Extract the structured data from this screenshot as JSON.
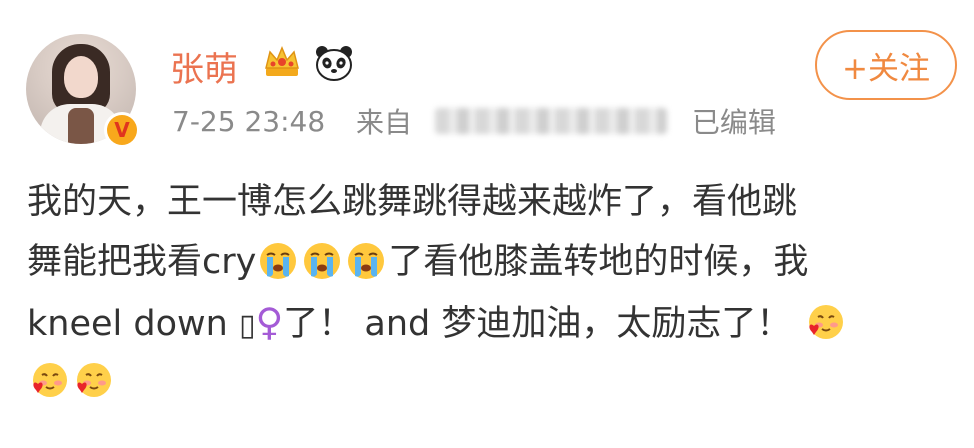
{
  "post": {
    "user": {
      "name": "张萌",
      "badges": [
        "crown-icon",
        "panda-icon"
      ],
      "verified_badge": "V"
    },
    "meta": {
      "time": "7-25 23:48",
      "from_label": "来自",
      "edited_label": "已编辑"
    },
    "follow_button": "+关注",
    "content": {
      "line1": "我的天，王一博怎么跳舞跳得越来越炸了，看他跳",
      "line2_a": "舞能把我看cry",
      "line2_b": "了看他膝盖转地的时候，我",
      "line3_a": "kneel down ",
      "line3_box": "▯",
      "line3_female": "♀",
      "line3_b": "了！ and 梦迪加油，太励志了！"
    },
    "emojis": {
      "cry": "crying-face-emoji",
      "love": "love-face-emoji"
    },
    "colors": {
      "username": "#eb7350",
      "follow": "#f08940",
      "meta": "#8a8a8a",
      "text": "#333333"
    }
  }
}
